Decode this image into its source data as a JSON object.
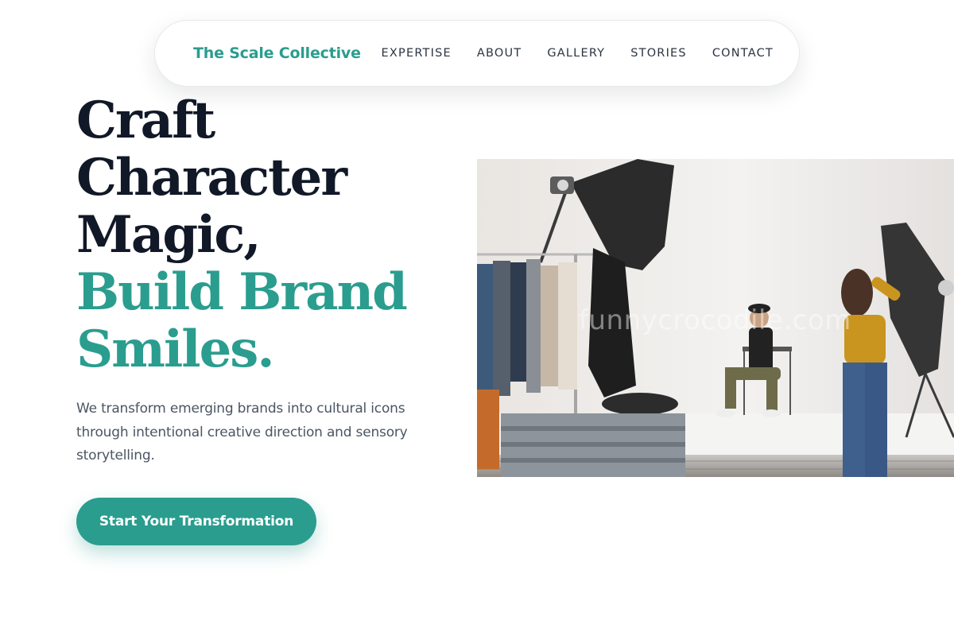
{
  "nav": {
    "brand": "The Scale Collective",
    "items": [
      {
        "label": "EXPERTISE"
      },
      {
        "label": "ABOUT"
      },
      {
        "label": "GALLERY"
      },
      {
        "label": "STORIES"
      },
      {
        "label": "CONTACT"
      }
    ]
  },
  "hero": {
    "headline_lines": [
      "Craft",
      "Character",
      "Magic,"
    ],
    "headline_accent_lines": [
      "Build Brand",
      "Smiles."
    ],
    "description": "We transform emerging brands into cultural icons through intentional creative direction and sensory storytelling.",
    "cta_label": "Start Your Transformation",
    "image": {
      "icon": "photo-studio-shoot",
      "watermark": "funnycrocodile.com"
    }
  },
  "colors": {
    "accent": "#2a9d8f",
    "heading": "#111827",
    "body_text": "#4b5563",
    "nav_text": "#2c3440"
  }
}
